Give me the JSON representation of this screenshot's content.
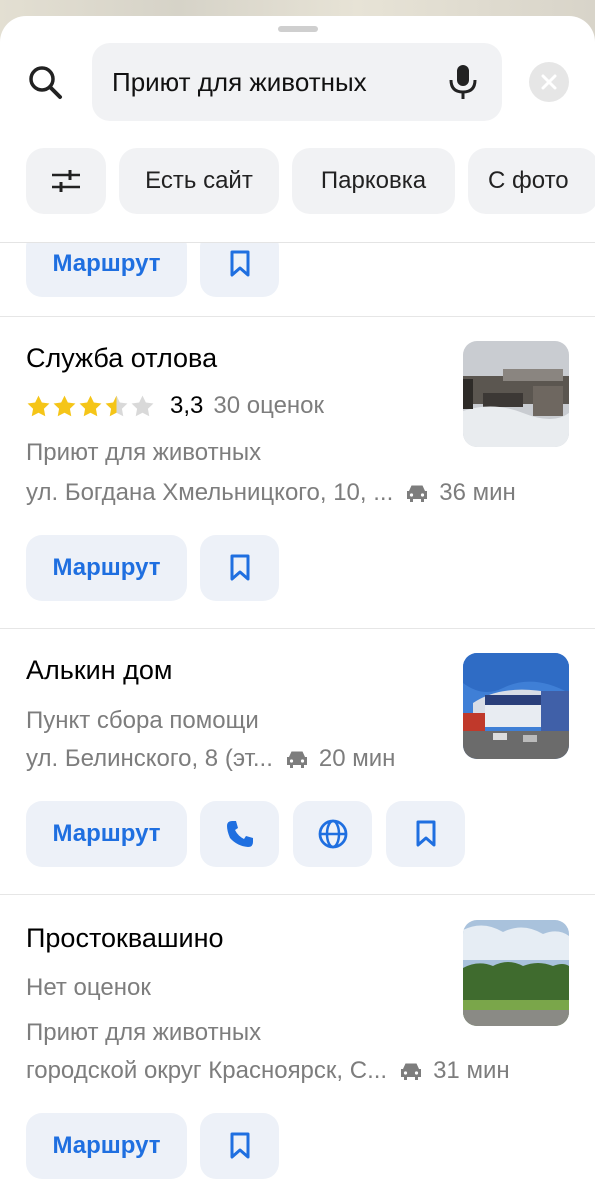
{
  "search": {
    "query": "Приют для животных",
    "icons": {
      "left": "search-icon",
      "voice": "microphone-icon",
      "clear": "close-icon"
    }
  },
  "filters": {
    "settings_icon": "sliders-icon",
    "chips": [
      "Есть сайт",
      "Парковка",
      "С фото"
    ]
  },
  "accent_color": "#1f6fe0",
  "star_color": "#f5c518",
  "results": [
    {
      "partial": true,
      "route_label": "Маршрут",
      "actions": [
        "bookmark-icon"
      ]
    },
    {
      "name": "Служба отлова",
      "rating": {
        "value": "3,3",
        "stars": 3.5,
        "count": "30 оценок"
      },
      "category": "Приют для животных",
      "address": "ул. Богдана Хмельницкого, 10, ...",
      "travel_time": "36 мин",
      "route_label": "Маршрут",
      "actions": [
        "bookmark-icon"
      ]
    },
    {
      "name": "Алькин дом",
      "category": "Пункт сбора помощи",
      "address": "ул. Белинского, 8 (эт...",
      "travel_time": "20 мин",
      "route_label": "Маршрут",
      "actions": [
        "phone-icon",
        "globe-icon",
        "bookmark-icon"
      ]
    },
    {
      "name": "Простоквашино",
      "rating_text": "Нет оценок",
      "category": "Приют для животных",
      "address": "городской округ Красноярск, С...",
      "travel_time": "31 мин",
      "route_label": "Маршрут",
      "actions": [
        "bookmark-icon"
      ]
    }
  ]
}
